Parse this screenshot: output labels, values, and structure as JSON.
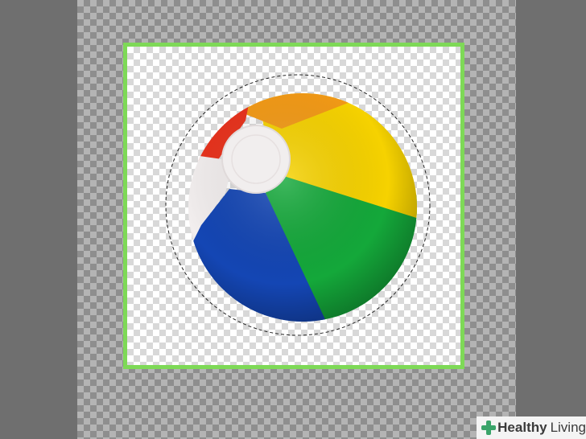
{
  "watermark": {
    "brand_bold": "Healthy",
    "brand_regular": "Living"
  },
  "colors": {
    "selection_border": "#7ed957",
    "ball_red": "#e8321c",
    "ball_orange": "#f39a16",
    "ball_yellow": "#f6d200",
    "ball_green": "#14a83a",
    "ball_blue": "#1446b4",
    "ball_white": "#f2eeee",
    "brand_green": "#3aa46a"
  }
}
